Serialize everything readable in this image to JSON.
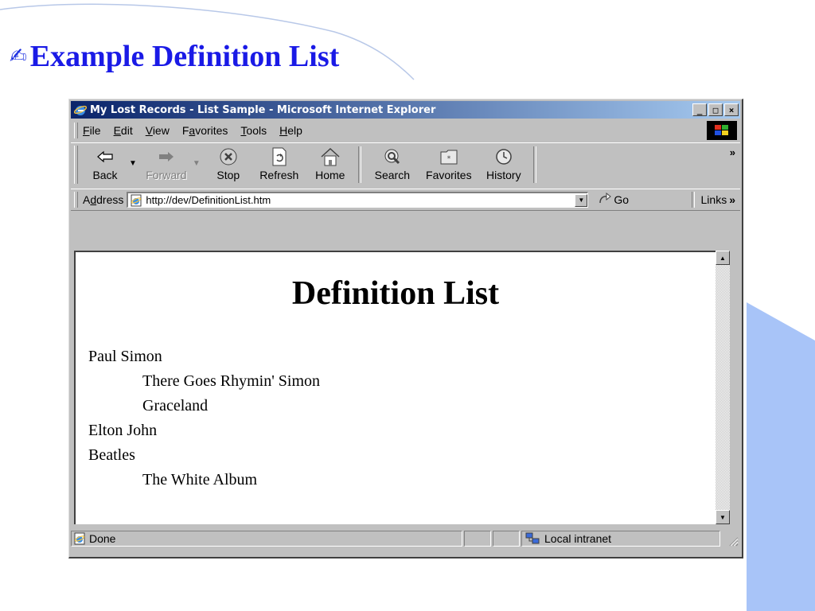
{
  "slide": {
    "title": "Example Definition List",
    "colors": {
      "title": "#1a1ae6",
      "accent_tab": "#a8c4f8"
    }
  },
  "window": {
    "title": "My Lost Records - List Sample - Microsoft Internet Explorer",
    "controls": {
      "minimize": "_",
      "maximize": "□",
      "close": "×"
    }
  },
  "menu": {
    "items": [
      {
        "label": "File",
        "key": "F",
        "rest": "ile"
      },
      {
        "label": "Edit",
        "key": "E",
        "rest": "dit"
      },
      {
        "label": "View",
        "key": "V",
        "rest": "iew"
      },
      {
        "label": "Favorites",
        "pre": "F",
        "key": "a",
        "rest": "vorites"
      },
      {
        "label": "Tools",
        "key": "T",
        "rest": "ools"
      },
      {
        "label": "Help",
        "key": "H",
        "rest": "elp"
      }
    ]
  },
  "toolbar": {
    "back": "Back",
    "forward": "Forward",
    "stop": "Stop",
    "refresh": "Refresh",
    "home": "Home",
    "search": "Search",
    "favorites": "Favorites",
    "history": "History",
    "more": "»"
  },
  "address": {
    "label_pre": "A",
    "label_key": "d",
    "label_rest": "dress",
    "url": "http://dev/DefinitionList.htm",
    "go": "Go",
    "links": "Links",
    "links_more": "»"
  },
  "page": {
    "heading": "Definition List",
    "list": [
      {
        "term": "Paul Simon",
        "defs": [
          "There Goes Rhymin' Simon",
          "Graceland"
        ]
      },
      {
        "term": "Elton John",
        "defs": []
      },
      {
        "term": "Beatles",
        "defs": [
          "The White Album"
        ]
      }
    ]
  },
  "status": {
    "text": "Done",
    "zone": "Local intranet"
  }
}
